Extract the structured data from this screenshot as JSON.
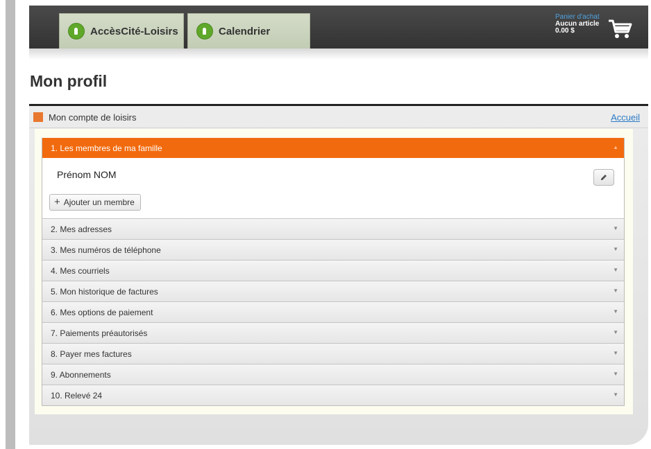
{
  "header": {
    "tabs": [
      {
        "label": "AccèsCité-Loisirs"
      },
      {
        "label": "Calendrier"
      }
    ],
    "cart": {
      "title": "Panier d'achat",
      "items": "Aucun article",
      "total": "0.00 $"
    }
  },
  "page": {
    "title": "Mon profil"
  },
  "panel": {
    "title": "Mon compte de loisirs",
    "accueil_link": "Accueil"
  },
  "accordion": {
    "active": {
      "label": "1. Les membres de ma famille",
      "member_name": "Prénom NOM",
      "add_member_label": "Ajouter un membre"
    },
    "items": [
      {
        "label": "2. Mes adresses"
      },
      {
        "label": "3. Mes numéros de téléphone"
      },
      {
        "label": "4. Mes courriels"
      },
      {
        "label": "5. Mon historique de factures"
      },
      {
        "label": "6. Mes options de paiement"
      },
      {
        "label": "7. Paiements préautorisés"
      },
      {
        "label": "8. Payer mes factures"
      },
      {
        "label": "9. Abonnements"
      },
      {
        "label": "10. Relevé 24"
      }
    ]
  },
  "colors": {
    "accent_orange": "#f26a0e",
    "header_dark": "#3a3a3a",
    "tab_green": "#5fa82a",
    "link_blue": "#2a7bc4"
  },
  "icons": {
    "tab_logo": "leaf-logo-icon",
    "cart": "shopping-cart-icon",
    "edit": "pencil-icon",
    "add": "plus-icon",
    "expand": "chevron-down-icon",
    "collapse": "chevron-up-icon"
  }
}
